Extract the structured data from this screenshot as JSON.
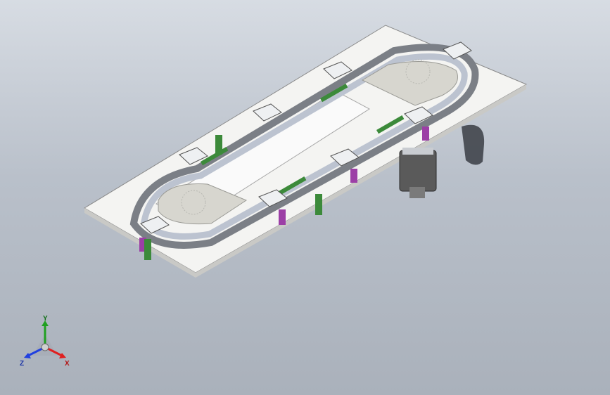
{
  "colors": {
    "background_top": "#d7dce3",
    "background_bottom": "#aab1bb",
    "base_plate": "#f4f4f2",
    "rail": "#bcc3d0",
    "green_part": "#3c8a3a",
    "purple_part": "#9c3fa6",
    "motor": "#5a5a5a",
    "axis_x": "#e02020",
    "axis_y": "#20a020",
    "axis_z": "#2040e0"
  },
  "icons": {
    "triad": "coordinate-axes-icon"
  },
  "axes": {
    "x_label": "X",
    "y_label": "Y",
    "z_label": "Z"
  }
}
